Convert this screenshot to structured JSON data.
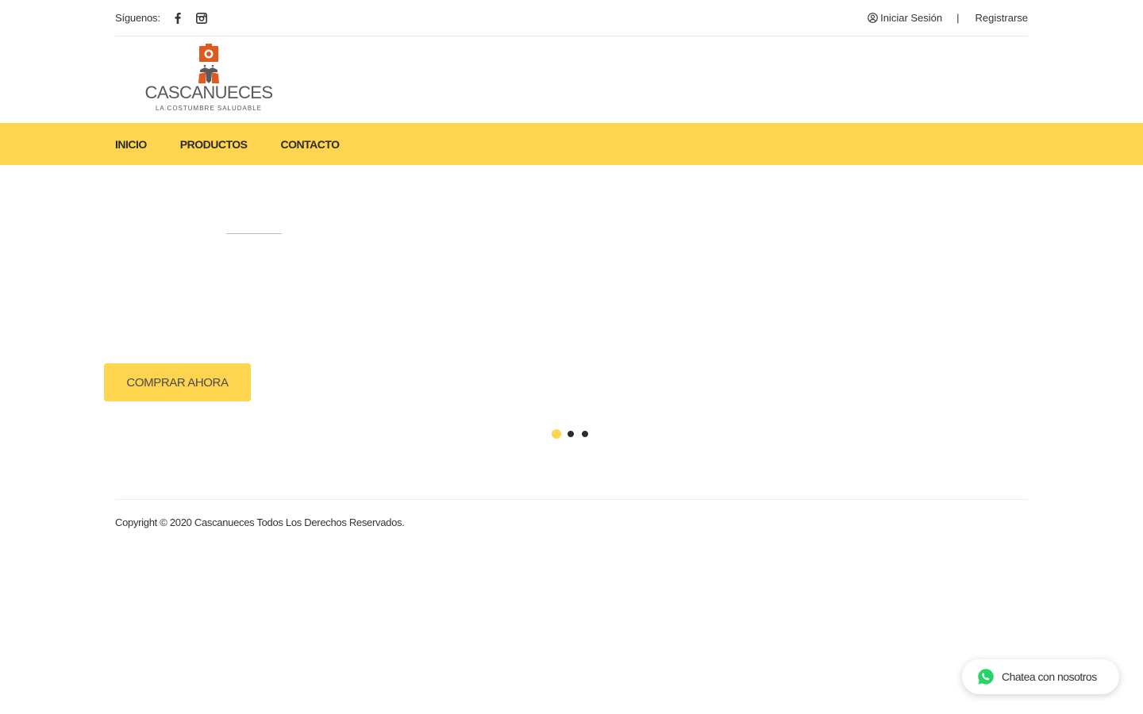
{
  "topbar": {
    "follow_label": "Síguenos:",
    "social": [
      {
        "icon": "facebook-icon"
      },
      {
        "icon": "instagram-icon"
      }
    ],
    "login_label": "Iniciar Sesión",
    "separator": "|",
    "register_label": "Registrarse"
  },
  "logo": {
    "brand": "CASCANUECES",
    "tagline": "LA COSTUMBRE SALUDABLE"
  },
  "nav": {
    "items": [
      {
        "label": "INICIO"
      },
      {
        "label": "PRODUCTOS"
      },
      {
        "label": "CONTACTO"
      }
    ]
  },
  "hero": {
    "cta_label": "COMPRAR AHORA",
    "slides_total": 3,
    "active_slide": 1
  },
  "footer": {
    "copyright": "Copyright © 2020 Cascanueces Todos Los Derechos Reservados."
  },
  "chat": {
    "label": "Chatea con nosotros",
    "icon": "whatsapp-icon"
  },
  "colors": {
    "accent": "#ffd54f",
    "text": "#333333",
    "logo_orange": "#e05a1e",
    "whatsapp": "#25d366"
  }
}
